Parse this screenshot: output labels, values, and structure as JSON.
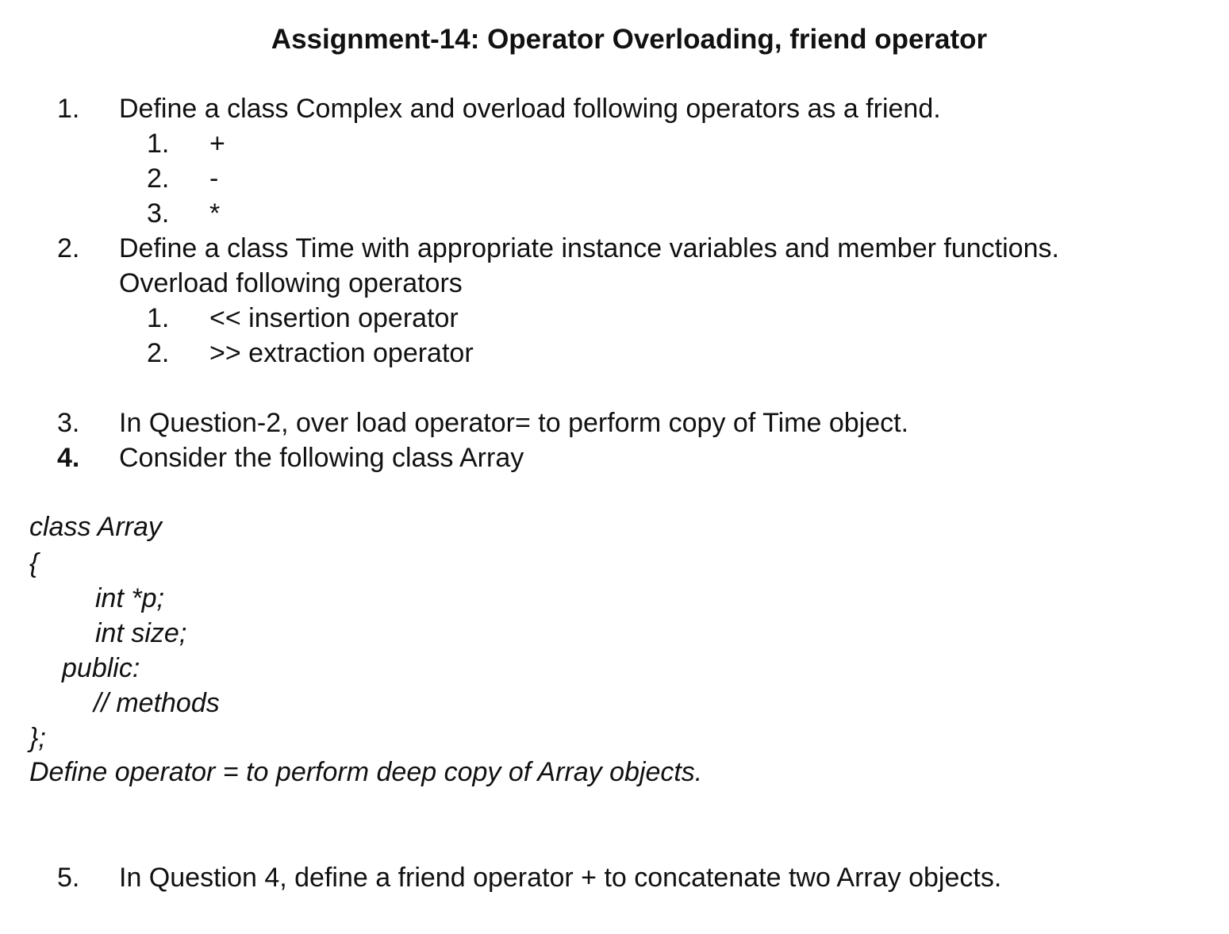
{
  "document": {
    "title": "Assignment-14: Operator Overloading, friend operator",
    "q1": {
      "number": "1.",
      "text": "Define a class Complex and overload following operators as a friend.",
      "subitems": [
        {
          "number": "1.",
          "text": "+"
        },
        {
          "number": "2.",
          "text": "-"
        },
        {
          "number": "3.",
          "text": "*"
        }
      ]
    },
    "q2": {
      "number": "2.",
      "text_line1": "Define a class Time with appropriate instance variables and member functions.",
      "text_line2": "Overload following operators",
      "subitems": [
        {
          "number": "1.",
          "text": "<< insertion operator"
        },
        {
          "number": "2.",
          "text": ">> extraction operator"
        }
      ]
    },
    "q3": {
      "number": "3.",
      "text": "In Question-2, over load operator= to perform copy of Time object."
    },
    "q4": {
      "number": "4.",
      "text": "Consider the following class Array"
    },
    "code": {
      "line1": "class Array",
      "line2": "{",
      "line3": "int *p;",
      "line4": "int size;",
      "line5": "public:",
      "line6": "// methods",
      "line7": "};"
    },
    "q4_instruction": "Define operator = to perform deep copy of Array objects.",
    "q5": {
      "number": "5.",
      "text": "In Question 4, define a friend operator + to concatenate two Array objects."
    }
  }
}
